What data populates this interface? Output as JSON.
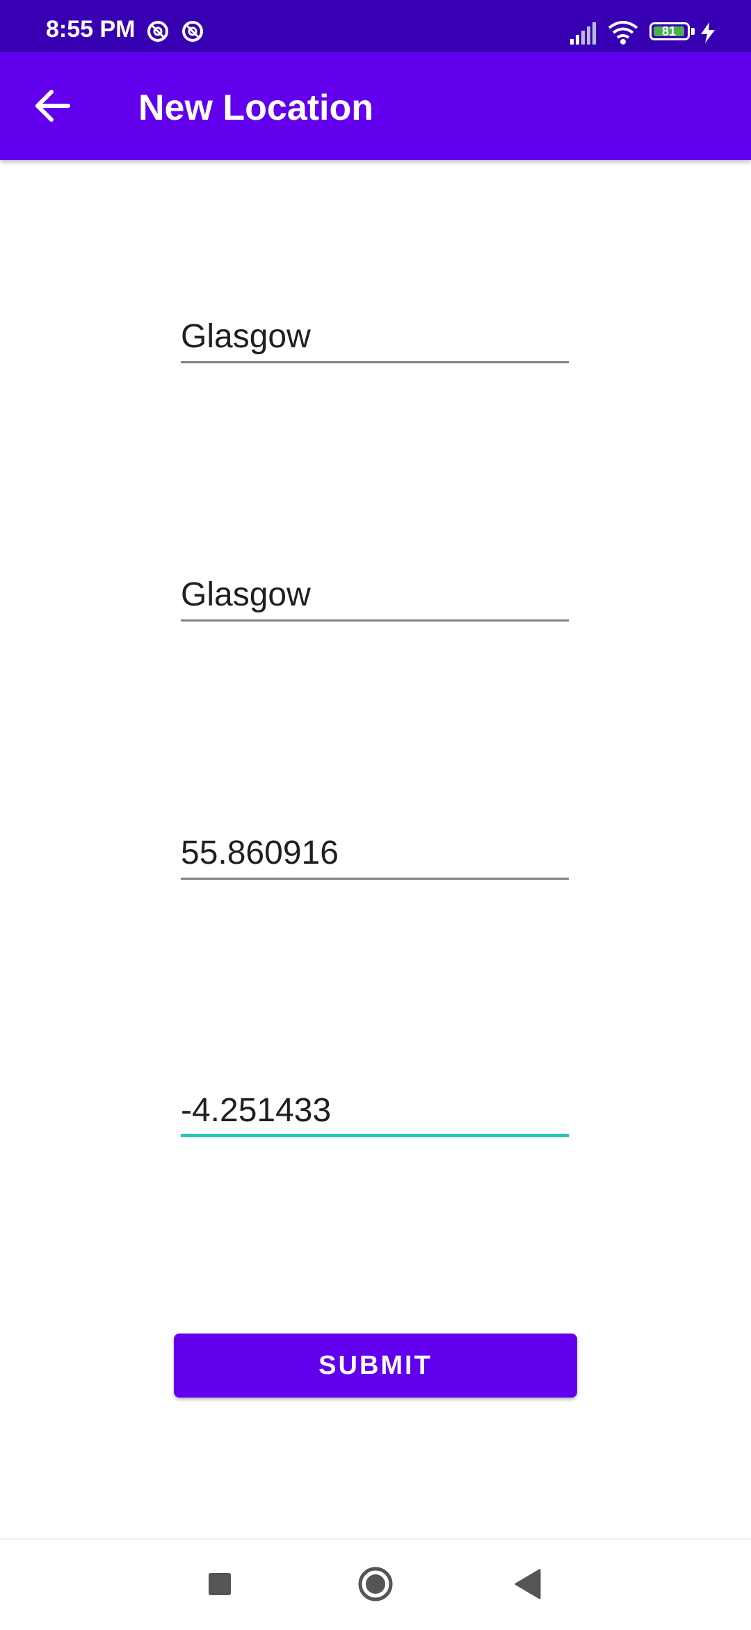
{
  "status_bar": {
    "time": "8:55 PM",
    "battery_level": "81",
    "icons": [
      "sync-icon",
      "sync-icon",
      "signal-icon",
      "wifi-icon",
      "battery-icon",
      "charging-icon"
    ]
  },
  "app_bar": {
    "title": "New Location",
    "back_icon": "arrow-left-icon",
    "color": "#6200ee"
  },
  "form": {
    "fields": [
      {
        "value": "Glasgow"
      },
      {
        "value": "Glasgow"
      },
      {
        "value": "55.860916"
      },
      {
        "value": "-4.251433",
        "focused": true
      }
    ],
    "submit_label": "SUBMIT",
    "accent_color": "#26c6b9"
  },
  "nav_bar": {
    "buttons": [
      "recents-square-icon",
      "home-circle-icon",
      "back-triangle-icon"
    ]
  }
}
